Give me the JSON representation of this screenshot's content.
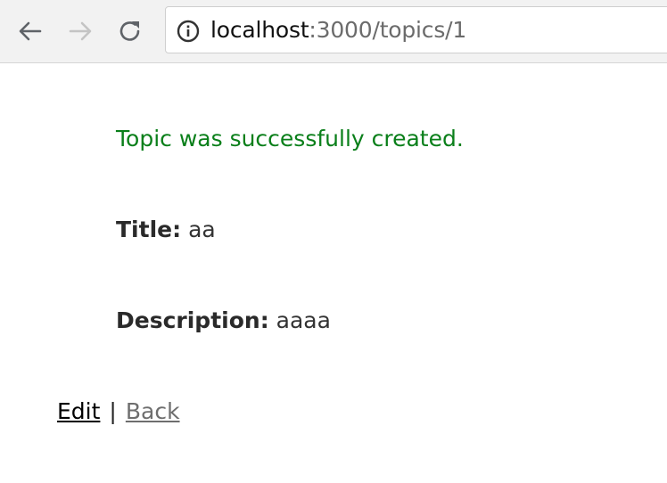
{
  "browser": {
    "url_host": "localhost",
    "url_path": ":3000/topics/1",
    "icons": {
      "back": "arrow-left-icon",
      "forward": "arrow-right-icon",
      "reload": "reload-icon",
      "info": "info-icon"
    }
  },
  "page": {
    "notice": "Topic was successfully created.",
    "title_label": "Title:",
    "title_value": "aa",
    "description_label": "Description:",
    "description_value": "aaaa",
    "edit_link": "Edit",
    "separator": "|",
    "back_link": "Back"
  },
  "colors": {
    "notice": "#0a7f1a",
    "toolbar_bg": "#f2f2f2"
  }
}
